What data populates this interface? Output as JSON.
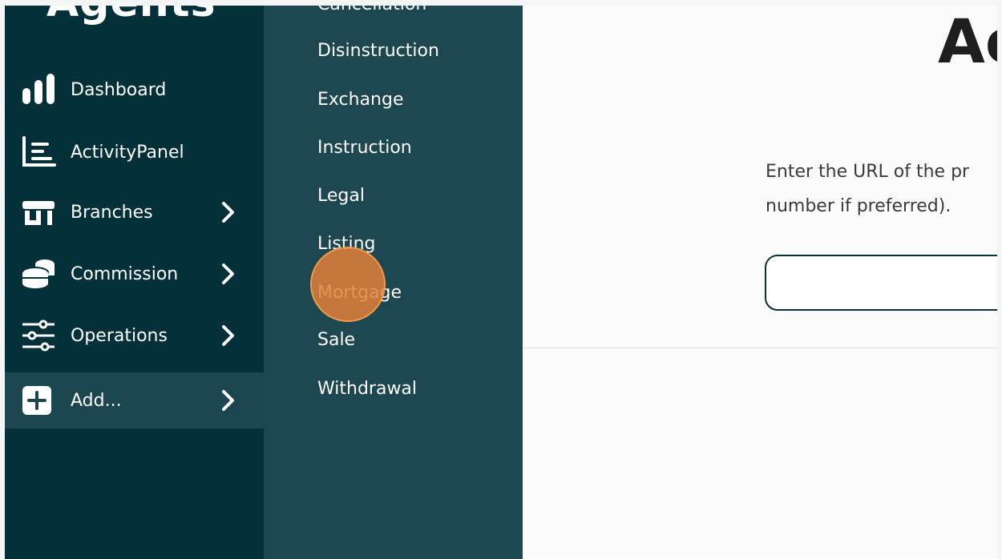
{
  "sidebar": {
    "logo": "Agents",
    "items": [
      {
        "label": "Dashboard",
        "icon": "bar-chart-icon",
        "has_submenu": false
      },
      {
        "label": "ActivityPanel",
        "icon": "activity-list-icon",
        "has_submenu": false
      },
      {
        "label": "Branches",
        "icon": "storefront-icon",
        "has_submenu": true
      },
      {
        "label": "Commission",
        "icon": "coins-icon",
        "has_submenu": true
      },
      {
        "label": "Operations",
        "icon": "sliders-icon",
        "has_submenu": true
      },
      {
        "label": "Add...",
        "icon": "plus-square-icon",
        "has_submenu": true,
        "active": true
      }
    ]
  },
  "submenu": {
    "items": [
      "Cancellation",
      "Disinstruction",
      "Exchange",
      "Instruction",
      "Legal",
      "Listing",
      "Mortgage",
      "Sale",
      "Withdrawal"
    ]
  },
  "main": {
    "heading": "Ac",
    "description": "Enter the URL of the pr\nnumber if preferred).",
    "url_input": {
      "value": "",
      "placeholder": ""
    }
  },
  "colors": {
    "sidebar_bg": "#04303a",
    "submenu_bg": "#1d4751",
    "active_bg": "#1c4750",
    "click_marker": "#e08038"
  }
}
